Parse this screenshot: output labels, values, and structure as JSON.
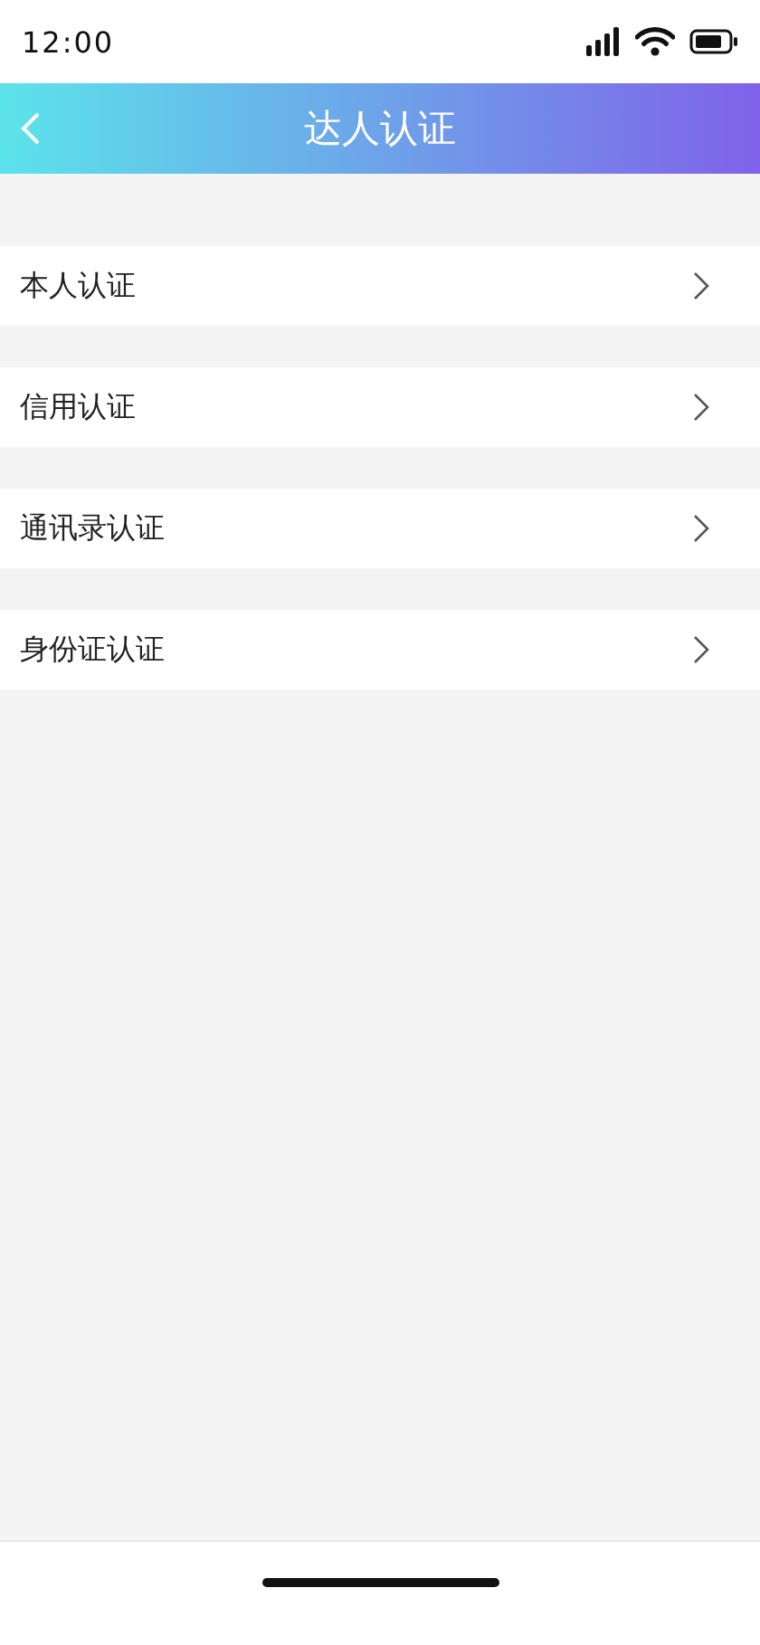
{
  "status_bar": {
    "time": "12:00"
  },
  "header": {
    "title": "达人认证"
  },
  "items": [
    {
      "label": "本人认证"
    },
    {
      "label": "信用认证"
    },
    {
      "label": "通讯录认证"
    },
    {
      "label": "身份证认证"
    }
  ]
}
